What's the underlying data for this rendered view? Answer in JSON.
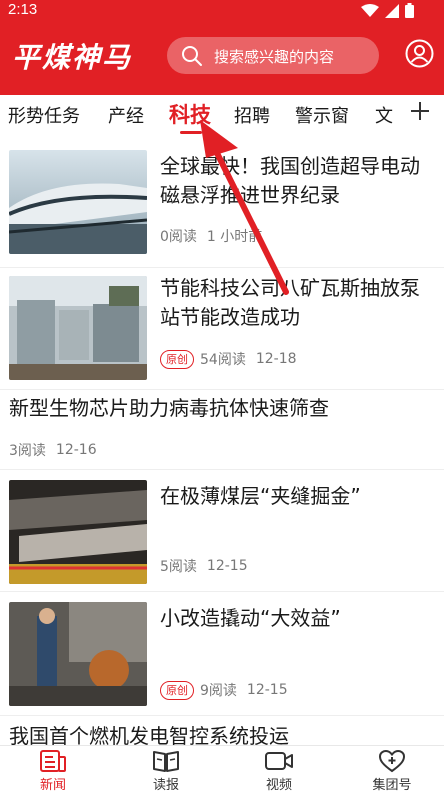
{
  "status_bar": {
    "time": "2:13"
  },
  "header": {
    "logo_text": "平煤神马",
    "search_placeholder": "搜索感兴趣的内容",
    "user_icon": "user-icon"
  },
  "tabs": [
    {
      "label": "形势任务"
    },
    {
      "label": "产经"
    },
    {
      "label": "科技",
      "active": true
    },
    {
      "label": "招聘"
    },
    {
      "label": "警示窗"
    },
    {
      "label": "文"
    }
  ],
  "add_tab_icon": "plus-icon",
  "feed": [
    {
      "title": "全球最快！我国创造超导电动磁悬浮推进世界纪录",
      "reads": "0阅读",
      "time": "1 小时前",
      "original": false,
      "has_image": true
    },
    {
      "title": "节能科技公司八矿瓦斯抽放泵站节能改造成功",
      "reads": "54阅读",
      "time": "12-18",
      "original": true,
      "badge": "原创",
      "has_image": true
    },
    {
      "title": "新型生物芯片助力病毒抗体快速筛查",
      "reads": "3阅读",
      "time": "12-16",
      "original": false,
      "has_image": false
    },
    {
      "title": "在极薄煤层“夹缝掘金”",
      "reads": "5阅读",
      "time": "12-15",
      "original": false,
      "has_image": true
    },
    {
      "title": "小改造撬动“大效益”",
      "reads": "9阅读",
      "time": "12-15",
      "original": true,
      "badge": "原创",
      "has_image": true
    },
    {
      "title": "我国首个燃机发电智控系统投运",
      "has_image": false
    }
  ],
  "bottom_nav": [
    {
      "label": "新闻",
      "icon": "news-icon",
      "active": true
    },
    {
      "label": "读报",
      "icon": "newspaper-icon"
    },
    {
      "label": "视频",
      "icon": "video-icon"
    },
    {
      "label": "集团号",
      "icon": "heart-plus-icon"
    }
  ],
  "colors": {
    "brand": "#e12025",
    "text": "#1a1a1a",
    "meta": "#777777"
  }
}
